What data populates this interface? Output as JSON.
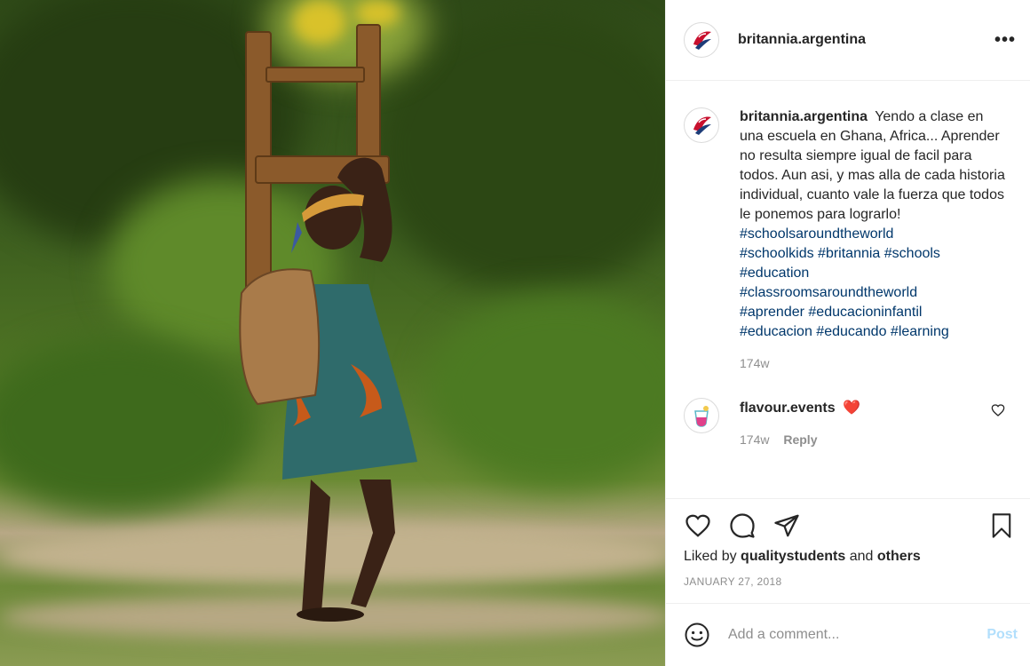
{
  "photo": {
    "description_icon": "photo-image"
  },
  "header": {
    "username": "britannia.argentina",
    "more_label": "•••"
  },
  "caption": {
    "username": "britannia.argentina",
    "text": "Yendo a clase en una escuela en Ghana, Africa... Aprender no resulta siempre igual de facil para todos. Aun asi, y mas alla de cada historia individual, cuanto vale la fuerza que todos le ponemos para lograrlo!",
    "tags_line1": "#schoolsaroundtheworld",
    "tags_line2": "#schoolkids #britannia #schools",
    "tags_line3": "#education",
    "tags_line4": "#classroomsaroundtheworld",
    "tags_line5": "#aprender #educacioninfantil",
    "tags_line6": "#educacion #educando #learning",
    "time": "174w"
  },
  "reply_comment": {
    "username": "flavour.events",
    "emoji": "❤️",
    "time": "174w",
    "reply_label": "Reply"
  },
  "actions": {
    "liked_prefix": "Liked by ",
    "liked_user": "qualitystudents",
    "liked_and": " and ",
    "liked_others": "others",
    "date": "JANUARY 27, 2018"
  },
  "add_comment": {
    "placeholder": "Add a comment...",
    "post_label": "Post"
  },
  "colors": {
    "link": "#00376b",
    "secondary_text": "#8e8e8e",
    "post_button": "#b2dffc",
    "reply_heart": "#e0245e"
  }
}
